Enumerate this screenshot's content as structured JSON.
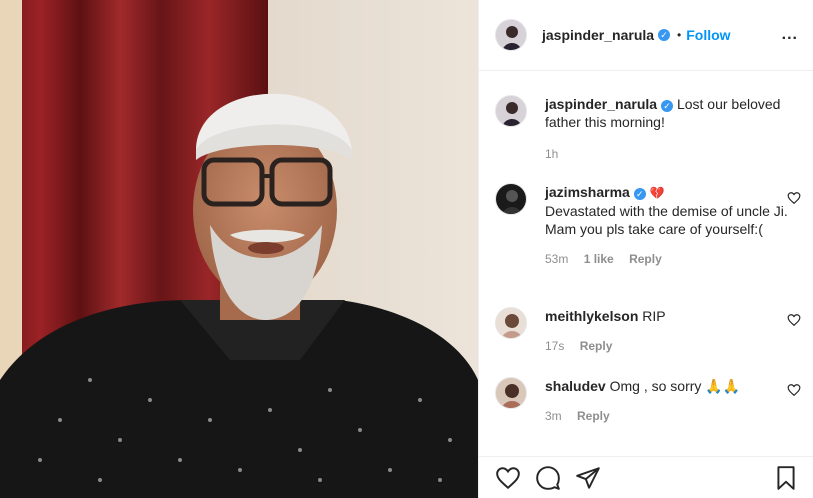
{
  "header": {
    "username": "jaspinder_narula",
    "dot": "•",
    "follow": "Follow",
    "more": "..."
  },
  "caption": {
    "username": "jaspinder_narula",
    "text": "Lost our beloved father this morning!",
    "time": "1h"
  },
  "comments": [
    {
      "username": "jazimsharma",
      "emoji": "💔",
      "text": "Devastated with the demise of uncle Ji. Mam you pls take care of yourself:(",
      "time": "53m",
      "likes": "1 like",
      "reply": "Reply"
    },
    {
      "username": "meithlykelson",
      "text": "RIP",
      "time": "17s",
      "reply": "Reply"
    },
    {
      "username": "shaludev",
      "text": "Omg , so sorry 🙏🙏",
      "time": "3m",
      "reply": "Reply"
    }
  ],
  "colors": {
    "follow": "#0095f6",
    "verified": "#3897f0",
    "muted": "#8e8e8e",
    "text": "#262626"
  },
  "icons": [
    "heart-icon",
    "comment-icon",
    "share-icon",
    "bookmark-icon",
    "verified-badge-icon",
    "more-options-icon"
  ]
}
